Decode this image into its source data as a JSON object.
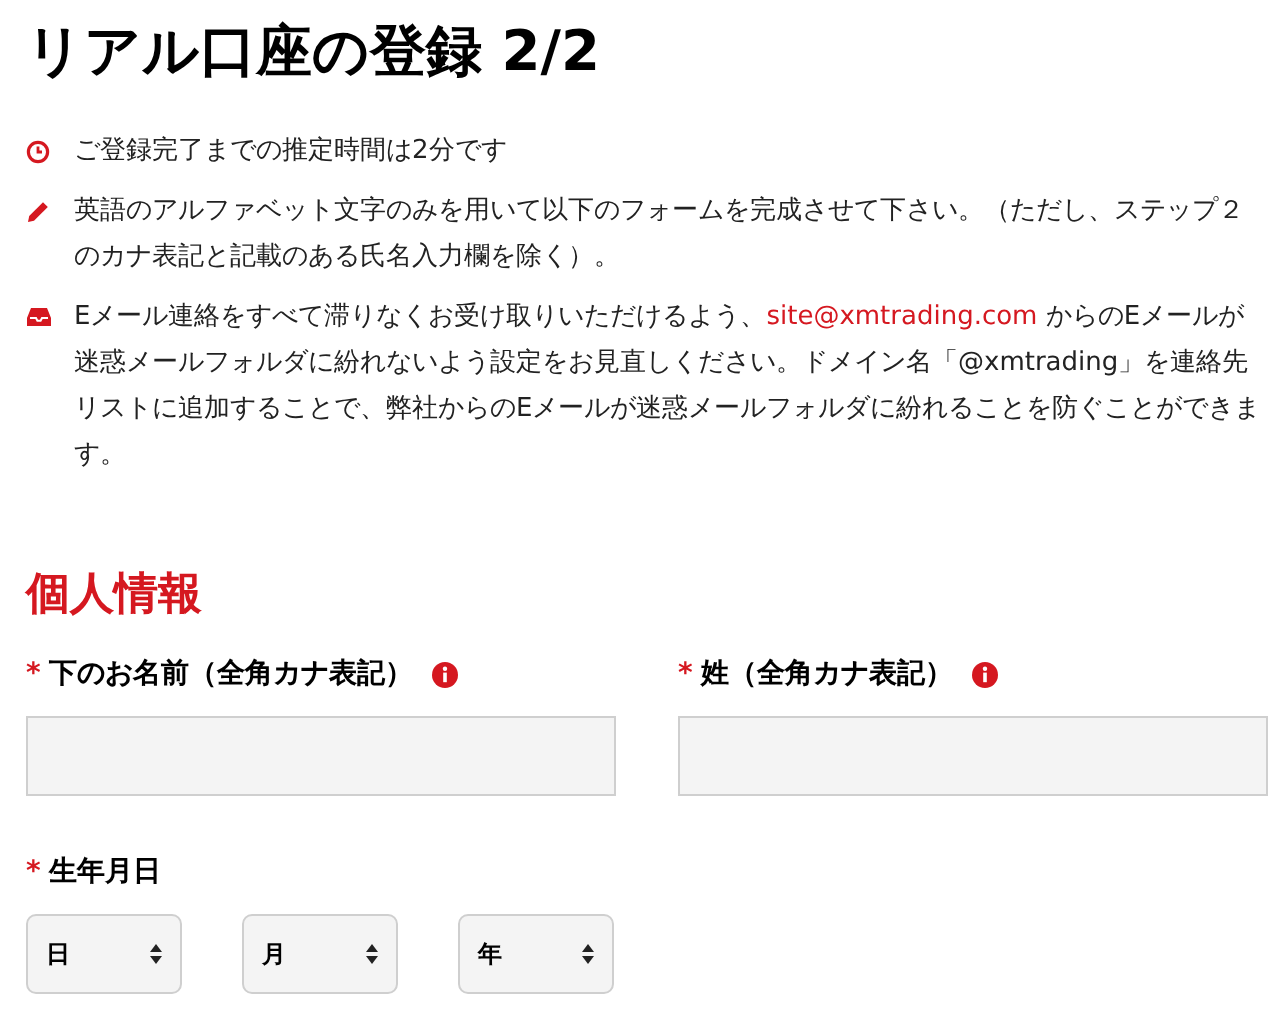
{
  "title": "リアル口座の登録 2/2",
  "notes": [
    {
      "kind": "clock",
      "parts": [
        {
          "text": "ご登録完了までの推定時間は2分です"
        }
      ]
    },
    {
      "kind": "pencil",
      "parts": [
        {
          "text": "英語のアルファベット文字のみを用いて以下のフォームを完成させて下さい。（ただし、ステップ２のカナ表記と記載のある氏名入力欄を除く）。"
        }
      ]
    },
    {
      "kind": "inbox",
      "parts": [
        {
          "text": "Eメール連絡をすべて滞りなくお受け取りいただけるよう、"
        },
        {
          "text": "site@xmtrading.com",
          "link": true
        },
        {
          "text": " からのEメールが迷惑メールフォルダに紛れないよう設定をお見直しください。ドメイン名「@xmtrading」を連絡先リストに追加することで、弊社からのEメールが迷惑メールフォルダに紛れることを防ぐことができます。"
        }
      ]
    }
  ],
  "section": {
    "title": "個人情報",
    "name_fields": [
      {
        "required_mark": "*",
        "label": "下のお名前（全角カナ表記）",
        "info": true
      },
      {
        "required_mark": "*",
        "label": "姓（全角カナ表記）",
        "info": true
      }
    ],
    "birthdate": {
      "required_mark": "*",
      "label": "生年月日",
      "selects": [
        "日",
        "月",
        "年"
      ]
    }
  }
}
